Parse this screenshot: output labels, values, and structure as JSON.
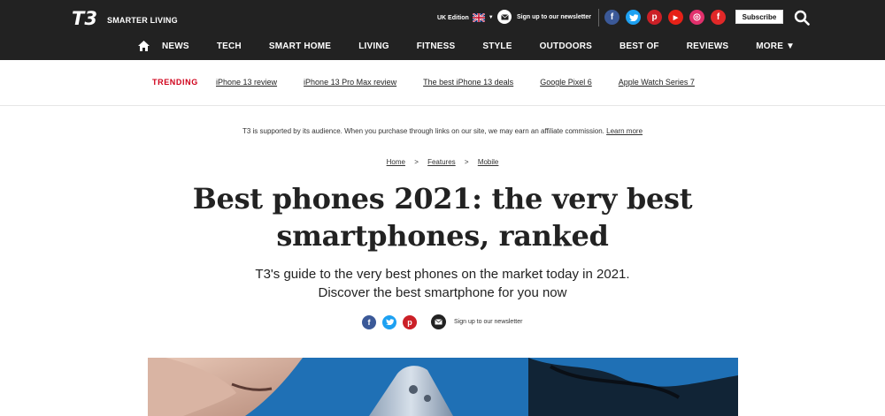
{
  "header": {
    "logo_text": "T3",
    "tagline": "SMARTER LIVING",
    "edition": "UK Edition",
    "newsletter_label": "Sign up to our newsletter",
    "subscribe_label": "Subscribe",
    "socials": [
      {
        "name": "facebook",
        "glyph": "f",
        "color": "#3b5998"
      },
      {
        "name": "twitter",
        "glyph": "t",
        "color": "#1da1f2"
      },
      {
        "name": "pinterest",
        "glyph": "p",
        "color": "#cb2027"
      },
      {
        "name": "youtube",
        "glyph": "▶",
        "color": "#e62117"
      },
      {
        "name": "instagram",
        "glyph": "◎",
        "color": "#e1306c"
      },
      {
        "name": "flipboard",
        "glyph": "f",
        "color": "#e12828"
      }
    ]
  },
  "nav": {
    "items": [
      "NEWS",
      "TECH",
      "SMART HOME",
      "LIVING",
      "FITNESS",
      "STYLE",
      "OUTDOORS",
      "BEST OF",
      "REVIEWS",
      "MORE ▼"
    ]
  },
  "trending": {
    "label": "TRENDING",
    "links": [
      "iPhone 13 review",
      "iPhone 13 Pro Max review",
      "The best iPhone 13 deals",
      "Google Pixel 6",
      "Apple Watch Series 7"
    ]
  },
  "disclaimer": {
    "text": "T3 is supported by its audience. When you purchase through links on our site, we may earn an affiliate commission. ",
    "link": "Learn more"
  },
  "breadcrumb": [
    "Home",
    "Features",
    "Mobile"
  ],
  "article": {
    "title": "Best phones 2021: the very best smartphones, ranked",
    "standfirst_line1": "T3's guide to the very best phones on the market today in 2021.",
    "standfirst_line2": "Discover the best smartphone for you now",
    "share_newsletter": "Sign up to our newsletter"
  },
  "colors": {
    "header_bg": "#222222",
    "trending_red": "#d0021b"
  }
}
